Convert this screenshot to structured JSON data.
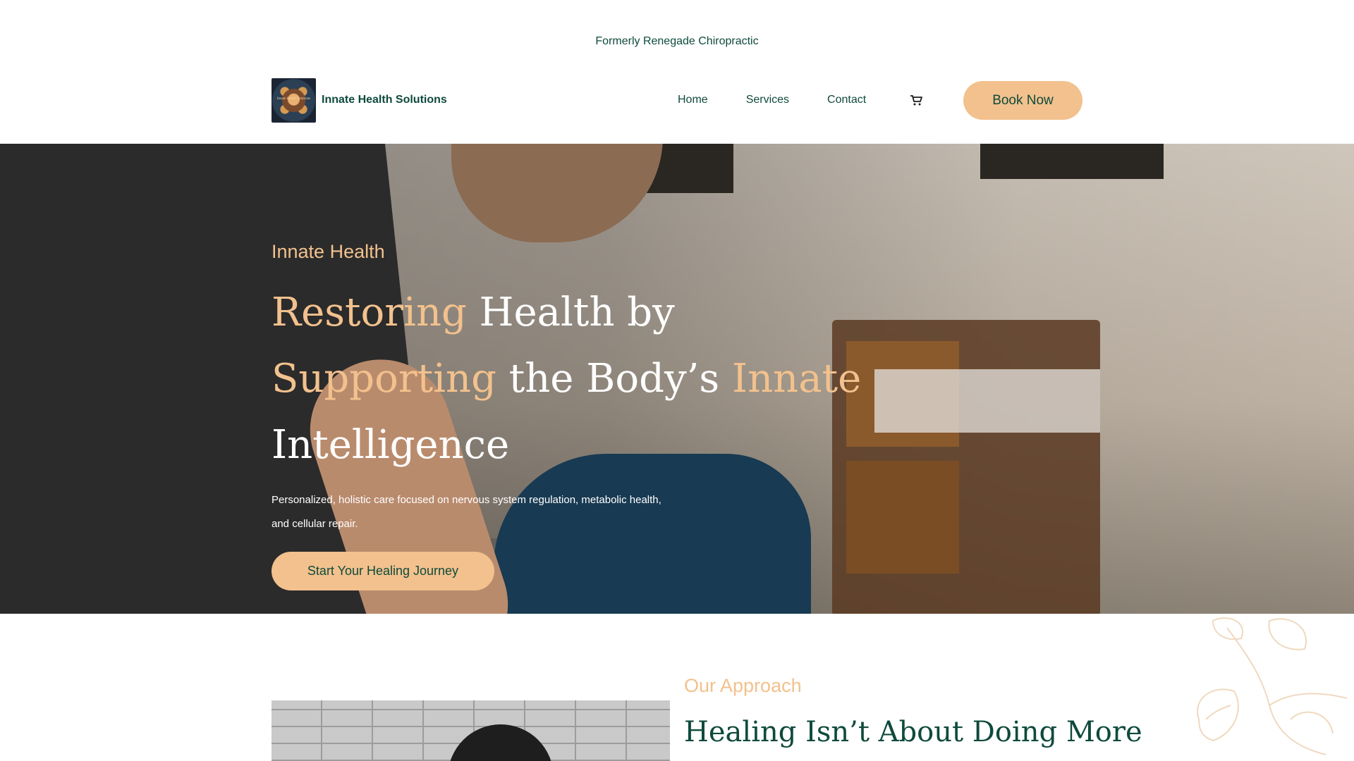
{
  "topbar": {
    "note": "Formerly Renegade Chiropractic"
  },
  "header": {
    "logo_text": "Innate Health Solutions",
    "brand": "Innate Health Solutions",
    "nav": [
      "Home",
      "Services",
      "Contact"
    ],
    "cart_icon": "shopping-cart-icon",
    "book_label": "Book Now"
  },
  "hero": {
    "eyebrow": "Innate Health",
    "headline_parts": [
      "Restoring",
      " Health by ",
      "Supporting",
      " the Body’s ",
      "Innate",
      " Intelligence"
    ],
    "subtext": "Personalized, holistic care focused on nervous system regulation, metabolic health, and cellular repair.",
    "cta": "Start Your Healing Journey"
  },
  "approach": {
    "eyebrow": "Our Approach",
    "title": "Healing Isn’t About Doing More"
  },
  "colors": {
    "brand": "#0e4a3c",
    "accent": "#f2c18d",
    "white": "#ffffff"
  }
}
